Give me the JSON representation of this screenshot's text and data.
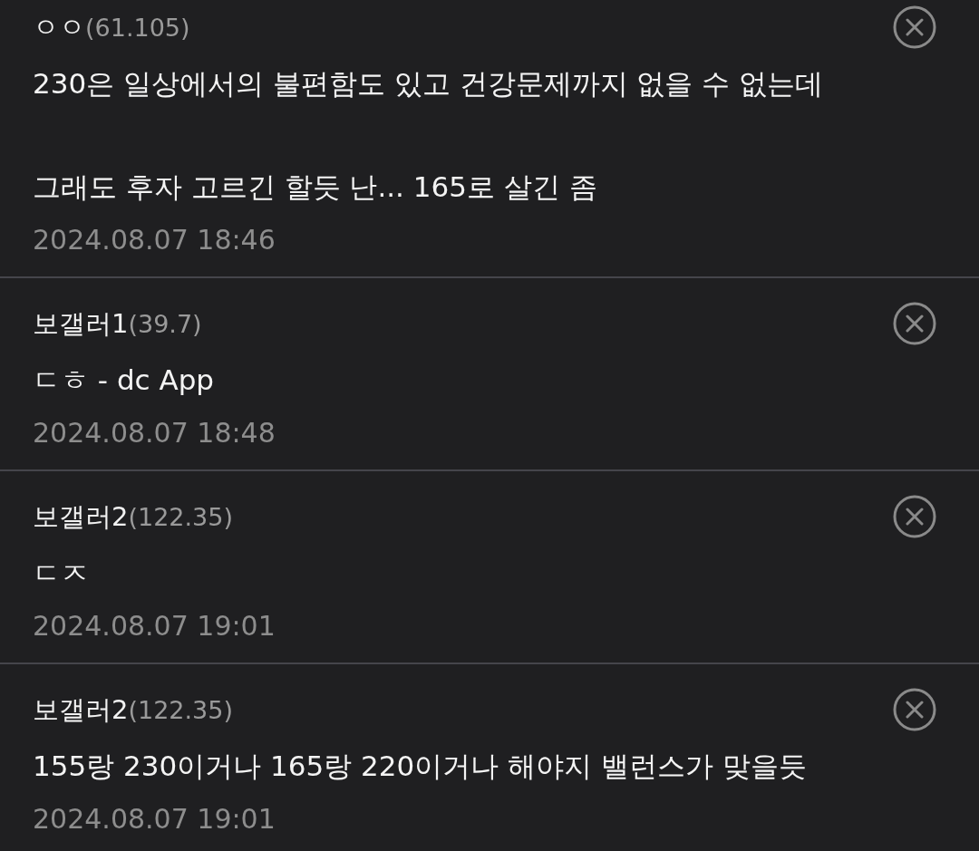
{
  "comments": [
    {
      "name": "ㅇㅇ",
      "ip": "(61.105)",
      "body": "230은 일상에서의 불편함도 있고 건강문제까지 없을 수 없는데\n\n그래도 후자 고르긴 할듯 난... 165로 살긴 좀",
      "date": "2024.08.07 18:46"
    },
    {
      "name": "보갤러1",
      "ip": "(39.7)",
      "body": "ㄷㅎ - dc App",
      "date": "2024.08.07 18:48"
    },
    {
      "name": "보갤러2",
      "ip": "(122.35)",
      "body": "ㄷㅈ",
      "date": "2024.08.07 19:01"
    },
    {
      "name": "보갤러2",
      "ip": "(122.35)",
      "body": "155랑 230이거나 165랑 220이거나 해야지 밸런스가 맞을듯",
      "date": "2024.08.07 19:01"
    }
  ]
}
